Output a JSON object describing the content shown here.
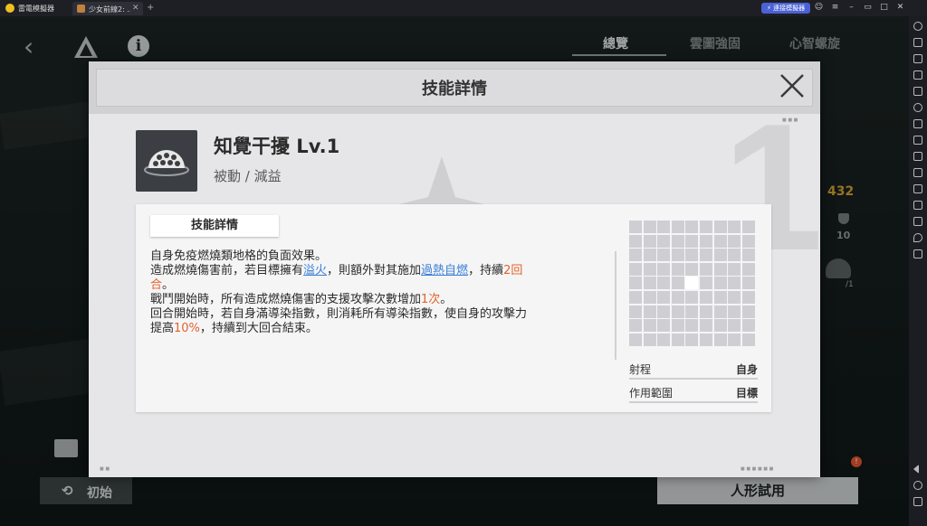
{
  "emulator": {
    "app_name": "雷電模擬器",
    "tab_title": "少女前線2: ...",
    "tab_close": "✕",
    "add_tab": "+",
    "sync_label": "⚡ 連接模擬器",
    "window_buttons": [
      "☺",
      "≡",
      "–",
      "▭",
      "□",
      "✕"
    ]
  },
  "game": {
    "back": "‹",
    "info": "i",
    "tabs": [
      {
        "label": "總覽",
        "active": true
      },
      {
        "label": "雲圖強固",
        "active": false
      },
      {
        "label": "心智螺旋",
        "active": false
      }
    ],
    "stat_value": "432",
    "stat_defense": "10",
    "stat_slot": "/1",
    "reset_icon": "⟲",
    "reset_label": "初始",
    "trial_label": "人形試用",
    "badge": "!"
  },
  "modal": {
    "title": "技能詳情",
    "background_number": "1",
    "skill": {
      "name": "知覺干擾 Lv.1",
      "type": "被動 / 減益"
    },
    "detail_tab": "技能詳情",
    "description": {
      "line1": "自身免疫燃燒類地格的負面效果。",
      "line2_a": "造成燃燒傷害前，若目標擁有",
      "line2_link1": "溢火",
      "line2_b": "，則額外對其施加",
      "line2_link2": "過熱自燃",
      "line2_c": "，持續",
      "line2_num": "2回",
      "line3_num": "合",
      "line3_rest": "。",
      "line4_a": "戰鬥開始時，所有造成燃燒傷害的支援攻擊次數增加",
      "line4_num": "1次",
      "line4_b": "。",
      "line5": "回合開始時，若自身滿導染指數，則消耗所有導染指數，使自身的攻擊力",
      "line6_a": "提高",
      "line6_num": "10%",
      "line6_b": "，持續到大回合結束。"
    },
    "range": {
      "label": "射程",
      "value": "自身"
    },
    "area": {
      "label": "作用範圍",
      "value": "目標"
    }
  },
  "colors": {
    "highlight_blue": "#3a7fd8",
    "highlight_orange": "#e2622a",
    "stat_gold": "#c89a30",
    "sync_button": "#4b62d6"
  }
}
